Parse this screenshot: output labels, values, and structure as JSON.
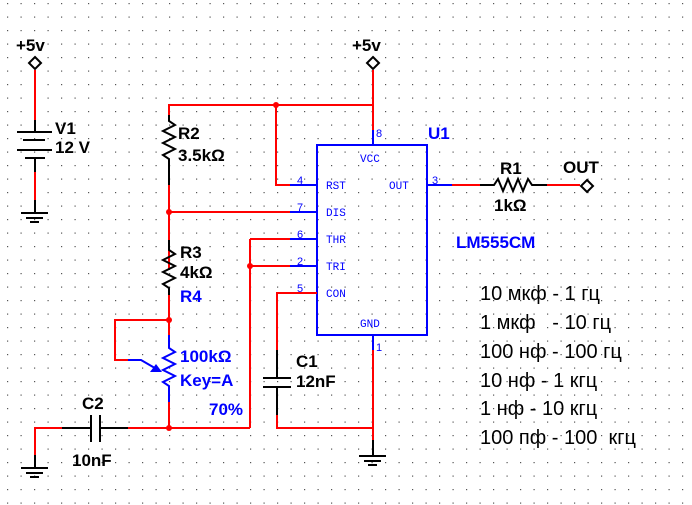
{
  "colors": {
    "wire": "#ff0000",
    "component": "#000000",
    "ic": "#0000ff"
  },
  "power": [
    {
      "label": "+5v"
    },
    {
      "label": "+5v"
    }
  ],
  "v1": {
    "name": "V1",
    "value": "12 V"
  },
  "r1": {
    "name": "R1",
    "value": "1kΩ"
  },
  "r2": {
    "name": "R2",
    "value": "3.5kΩ"
  },
  "r3": {
    "name": "R3",
    "value": "4kΩ"
  },
  "r4": {
    "name": "R4",
    "value": "100kΩ",
    "key": "Key=A",
    "setting": "70%"
  },
  "c1": {
    "name": "C1",
    "value": "12nF"
  },
  "c2": {
    "name": "C2",
    "value": "10nF"
  },
  "out": {
    "label": "OUT"
  },
  "u1": {
    "name": "U1",
    "part": "LM555CM",
    "pins": {
      "vcc": "VCC",
      "rst": "RST",
      "out": "OUT",
      "dis": "DIS",
      "thr": "THR",
      "tri": "TRI",
      "con": "CON",
      "gnd": "GND"
    },
    "pin_numbers": {
      "vcc": "8",
      "rst": "4",
      "dis": "7",
      "thr": "6",
      "tri": "2",
      "con": "5",
      "out": "3",
      "gnd": "1"
    }
  },
  "notes": [
    "10 мкф - 1 гц",
    "1 мкф   - 10 гц",
    "100 нф - 100 гц",
    "10 нф - 1 кгц",
    "1 нф - 10 кгц",
    "100 пф - 100  кгц"
  ]
}
